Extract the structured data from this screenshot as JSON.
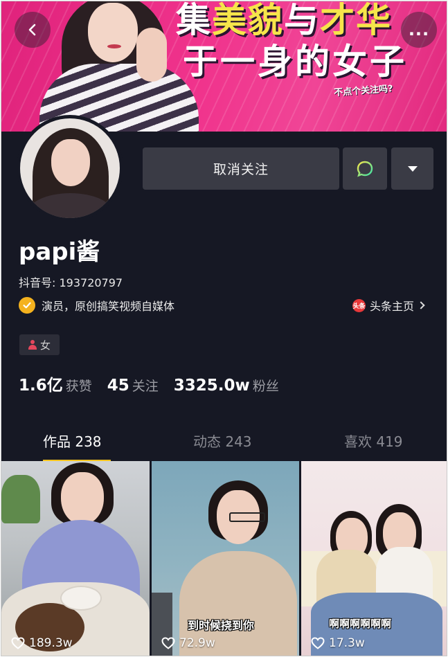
{
  "banner": {
    "line1_a": "集",
    "line1_b": "美貌",
    "line1_c": "与",
    "line1_d": "才华",
    "line2": "于一身的女子",
    "subline": "不点个关注吗?"
  },
  "actions": {
    "unfollow_label": "取消关注",
    "more_glyph": "..."
  },
  "profile": {
    "name": "papi酱",
    "douyin_id": "抖音号: 193720797",
    "verified_desc": "演员，原创搞笑视频自媒体",
    "toutiao_icon_text": "头条",
    "toutiao_label": "头条主页",
    "gender": "女"
  },
  "stats": [
    {
      "value": "1.6亿",
      "label": "获赞"
    },
    {
      "value": "45",
      "label": "关注"
    },
    {
      "value": "3325.0w",
      "label": "粉丝"
    }
  ],
  "tabs": [
    {
      "label": "作品 238",
      "active": true
    },
    {
      "label": "动态 243",
      "active": false
    },
    {
      "label": "喜欢 419",
      "active": false
    }
  ],
  "videos": [
    {
      "likes": "189.3w",
      "caption": ""
    },
    {
      "likes": "72.9w",
      "caption": "到时候挠到你"
    },
    {
      "likes": "17.3w",
      "caption": "啊啊啊啊啊啊"
    }
  ],
  "colors": {
    "background": "#161824",
    "banner_pink": "#f0338c",
    "button_gray": "#3a3b45",
    "tab_underline": "#f5c51f",
    "verified_badge": "#f4b21e",
    "chat_icon_green": "#3be3a8"
  },
  "icons": {
    "back": "chevron-left-icon",
    "more": "more-icon",
    "chat": "chat-bubble-icon",
    "dropdown": "triangle-down-icon",
    "verified": "check-badge-icon",
    "toutiao": "toutiao-logo-icon",
    "gender": "person-icon",
    "like": "heart-icon"
  }
}
